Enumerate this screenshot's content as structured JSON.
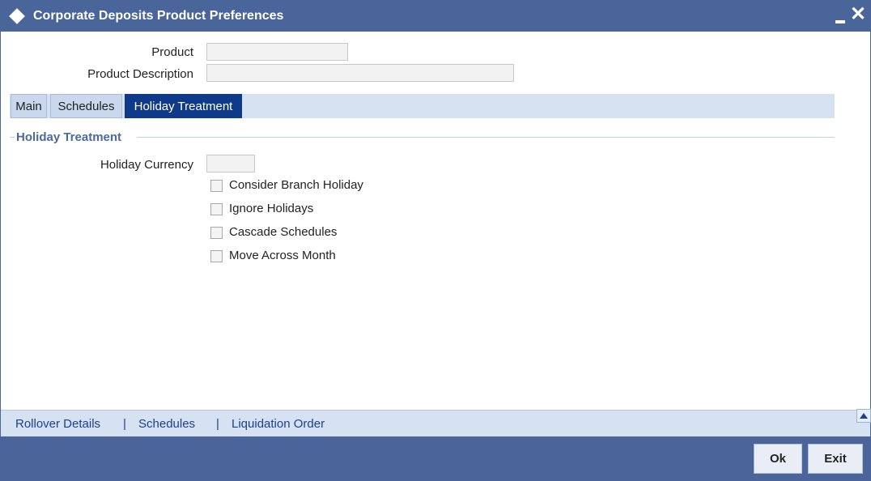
{
  "window": {
    "title": "Corporate Deposits Product Preferences",
    "minimize_icon": "minimize-icon",
    "close_icon": "close-icon",
    "close_glyph": "✕"
  },
  "header": {
    "product_label": "Product",
    "product_value": "",
    "description_label": "Product Description",
    "description_value": ""
  },
  "tabs": [
    {
      "label": "Main",
      "active": false
    },
    {
      "label": "Schedules",
      "active": false
    },
    {
      "label": "Holiday Treatment",
      "active": true
    }
  ],
  "holiday_section": {
    "legend": "Holiday Treatment",
    "currency_label": "Holiday Currency",
    "currency_value": "",
    "checkboxes": [
      {
        "label": "Consider Branch Holiday",
        "checked": false
      },
      {
        "label": "Ignore Holidays",
        "checked": false
      },
      {
        "label": "Cascade Schedules",
        "checked": false
      },
      {
        "label": "Move Across Month",
        "checked": false
      }
    ]
  },
  "links": {
    "items": [
      "Rollover Details",
      "Schedules",
      "Liquidation Order"
    ],
    "separator": "|"
  },
  "footer": {
    "ok_label": "Ok",
    "exit_label": "Exit"
  },
  "colors": {
    "titlebar": "#49659a",
    "active_tab": "#0f3a8a",
    "tabstrip": "#d6e2f2",
    "legend": "#4c689c",
    "link": "#1d3f8c"
  }
}
